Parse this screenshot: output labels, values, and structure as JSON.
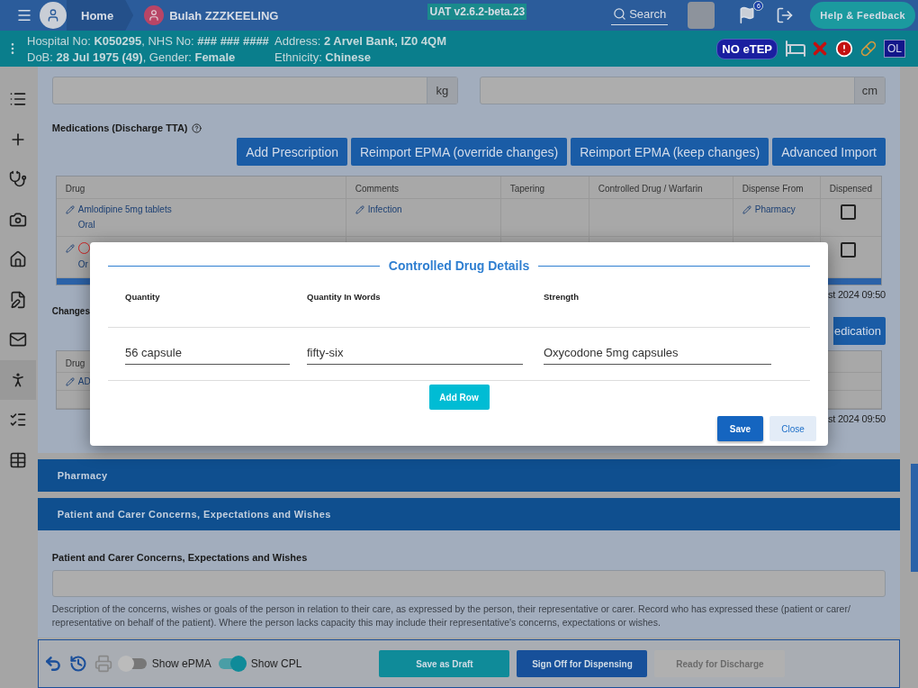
{
  "header": {
    "home": "Home",
    "patient_name": "Bulah ZZZKEELING",
    "version": "UAT v2.6.2-beta.23",
    "search": "Search",
    "notifications": "6",
    "help": "Help & Feedback"
  },
  "patient_bar": {
    "left": [
      "Hospital No: **K050295**, NHS No: **### ### ####**",
      "DoB: **28 Jul 1975 (49)**, Gender: **Female**"
    ],
    "right": [
      "Address: **2 Arvel Bank, IZ0 4QM**",
      "Ethnicity: **Chinese**"
    ],
    "etep": "NO eTEP",
    "ol": "OL"
  },
  "sidebar": [
    {
      "selected": false
    },
    {
      "selected": false
    },
    {
      "selected": false
    },
    {
      "selected": false
    },
    {
      "selected": false
    },
    {
      "selected": false
    },
    {
      "selected": false
    },
    {
      "selected": true
    },
    {
      "selected": false
    },
    {
      "selected": false
    }
  ],
  "measurements": [
    {
      "unit": "kg"
    },
    {
      "unit": "cm"
    }
  ],
  "medications": {
    "title": "Medications (Discharge TTA)",
    "buttons": [
      "Add Prescription",
      "Reimport EPMA (override changes)",
      "Reimport EPMA (keep changes)",
      "Advanced Import"
    ],
    "columns": [
      "Drug",
      "Comments",
      "Tapering",
      "Controlled Drug / Warfarin",
      "Dispense From",
      "Dispensed"
    ],
    "rows": [
      {
        "drug": "Amlodipine 5mg tablets",
        "route": "Oral",
        "comments": "Infection",
        "dispense_from": "Pharmacy",
        "dispensed": false,
        "controlled": false
      },
      {
        "drug": "",
        "route": "Or",
        "comments": "",
        "dispense_from": "",
        "dispensed": false,
        "controlled": true
      }
    ],
    "timestamp": "st 2024 09:50"
  },
  "changes": {
    "title": "Changes",
    "button": "edication",
    "columns": [
      "Drug"
    ],
    "rows": [
      {
        "drug": "AD"
      }
    ],
    "timestamp": "st 2024 09:50"
  },
  "sections": [
    {
      "title": "Pharmacy"
    },
    {
      "title": "Patient and Carer Concerns, Expectations and Wishes"
    }
  ],
  "concerns": {
    "label": "Patient and Carer Concerns, Expectations and Wishes",
    "help": "Description of the concerns, wishes or goals of the person in relation to their care, as expressed by the person, their representative or carer. Record who has expressed these (patient or carer/ representative on behalf of the patient). Where the person lacks capacity this may include their representative's concerns, expectations or wishes."
  },
  "footer": {
    "toggles": [
      {
        "label": "Show ePMA",
        "on": false
      },
      {
        "label": "Show CPL",
        "on": true
      }
    ],
    "buttons": [
      {
        "label": "Save as Draft",
        "kind": "teal",
        "disabled": false
      },
      {
        "label": "Sign Off for Dispensing",
        "kind": "blue",
        "disabled": false
      },
      {
        "label": "Ready for Discharge",
        "kind": "blue",
        "disabled": true
      }
    ]
  },
  "modal": {
    "title": "Controlled Drug Details",
    "columns": [
      "Quantity",
      "Quantity In Words",
      "Strength"
    ],
    "rows": [
      [
        "56 capsule",
        "fifty-six",
        "Oxycodone 5mg capsules"
      ]
    ],
    "add_row": "Add Row",
    "save": "Save",
    "close": "Close"
  }
}
